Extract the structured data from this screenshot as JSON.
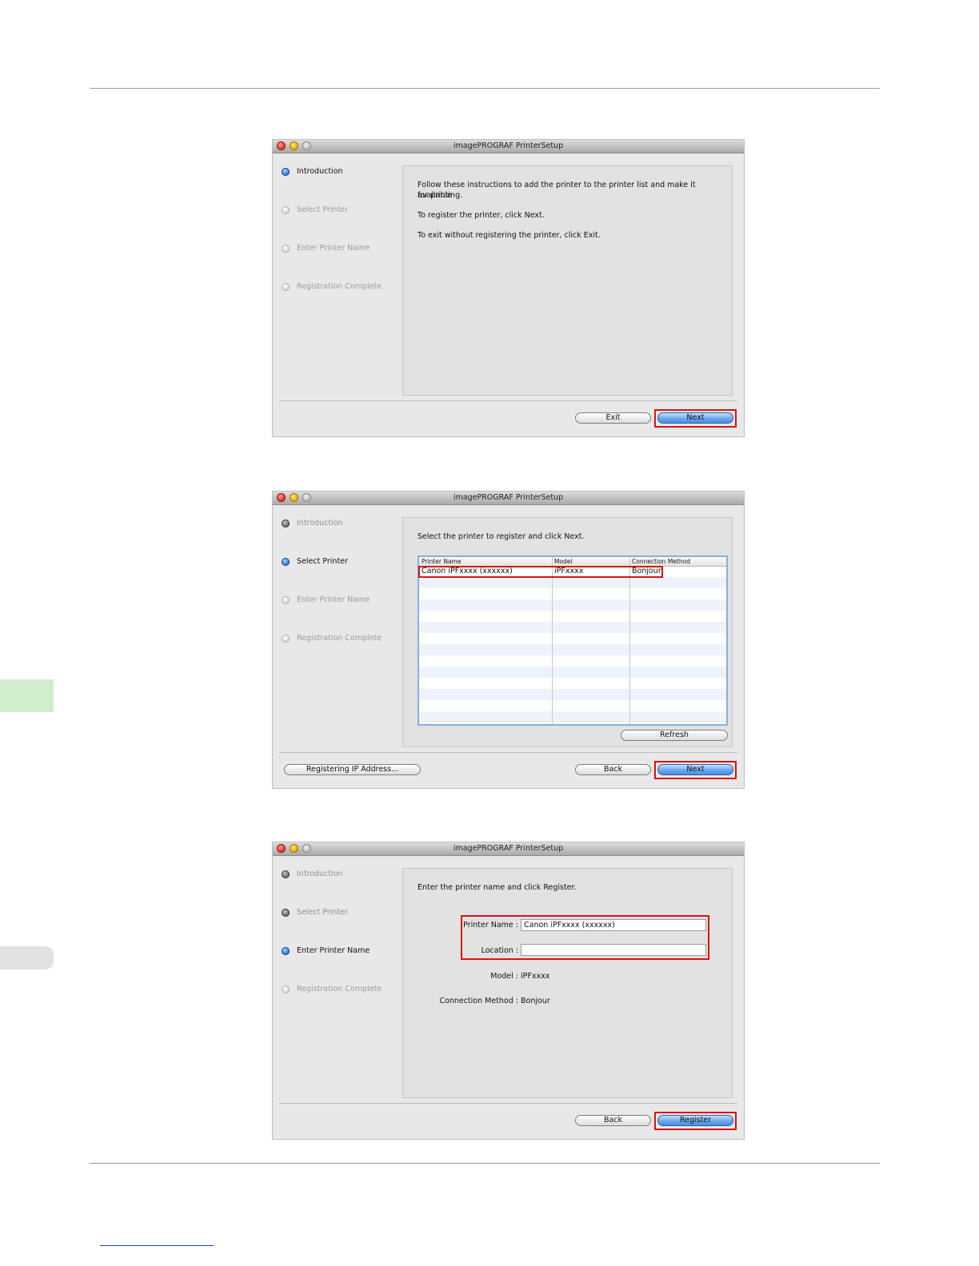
{
  "window_title": "imagePROGRAF PrinterSetup",
  "steps": [
    "Introduction",
    "Select Printer",
    "Enter Printer Name",
    "Registration Complete"
  ],
  "intro": {
    "line1": "Follow these instructions to add the printer to the printer list and make it available",
    "line2": "for printing.",
    "line3": "To register the printer, click Next.",
    "line4": "To exit without registering the printer, click Exit."
  },
  "select": {
    "instruction": "Select the printer to register and click Next.",
    "columns": [
      "Printer Name",
      "Model",
      "Connection Method"
    ],
    "rows": [
      {
        "name": "Canon iPFxxxx (xxxxxx)",
        "model": "iPFxxxx",
        "method": "Bonjour"
      }
    ]
  },
  "enter": {
    "instruction": "Enter the printer name and click Register.",
    "printer_name_label": "Printer Name :",
    "printer_name_value": "Canon iPFxxxx (xxxxxx)",
    "location_label": "Location :",
    "location_value": "",
    "model_label": "Model :",
    "model_value": "iPFxxxx",
    "method_label": "Connection Method :",
    "method_value": "Bonjour"
  },
  "buttons": {
    "exit": "Exit",
    "next": "Next",
    "back": "Back",
    "register": "Register",
    "refresh": "Refresh",
    "registering_ip": "Registering IP Address..."
  },
  "colors": {
    "highlight": "#dd1111",
    "side_tab_green": "#cfeecb",
    "accent_blue": "#4b8fe0"
  }
}
